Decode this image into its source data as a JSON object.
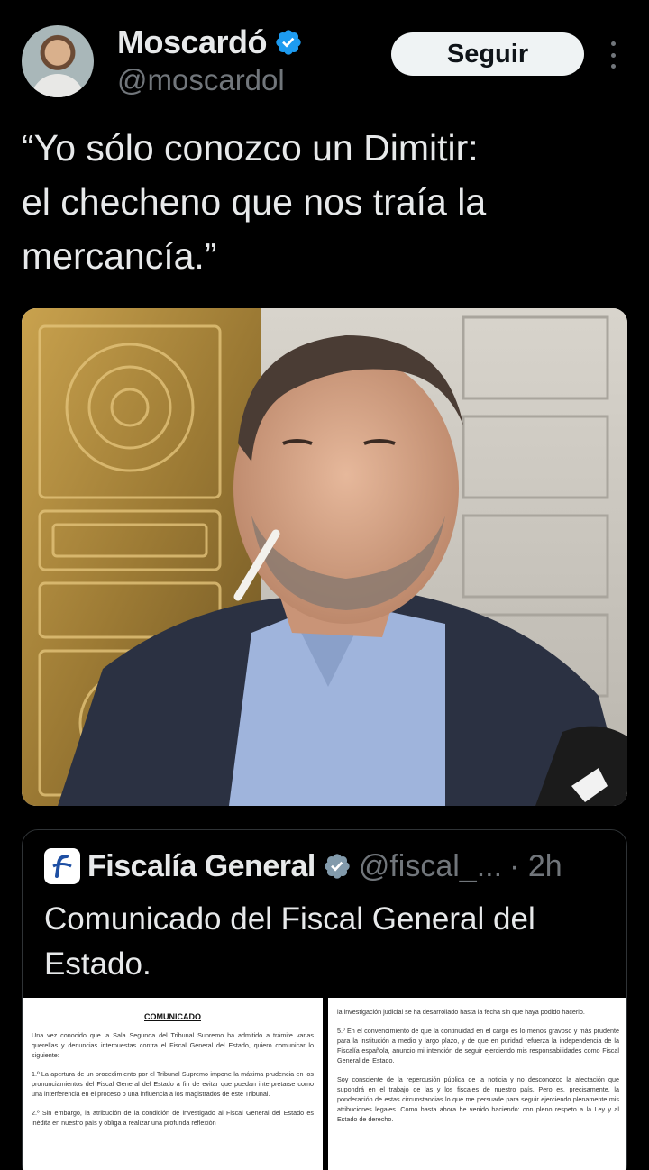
{
  "author": {
    "name": "Moscardó",
    "handle": "@moscardol",
    "verified": true
  },
  "actions": {
    "follow_label": "Seguir",
    "more_icon": "more-vertical-icon"
  },
  "tweet": {
    "text": "“Yo sólo conozco un Dimitir:\nel checheno que nos traía la\nmercancía.”"
  },
  "media": {
    "description_icon": "photo"
  },
  "quoted_tweet": {
    "author_name": "Fiscalía General",
    "author_handle": "@fiscal_...",
    "time": "· 2h",
    "text": "Comunicado del Fiscal General del Estado.",
    "documents": [
      {
        "title": "COMUNICADO",
        "paragraphs": [
          "Una vez conocido que la Sala Segunda del Tribunal Supremo ha admitido a trámite varias querellas y denuncias interpuestas contra el Fiscal General del Estado, quiero comunicar lo siguiente:",
          "1.º La apertura de un procedimiento por el Tribunal Supremo impone la máxima prudencia en los pronunciamientos del Fiscal General del Estado a fin de evitar que puedan interpretarse como una interferencia en el proceso o una influencia a los magistrados de este Tribunal.",
          "2.º Sin embargo, la atribución de la condición de investigado al Fiscal General del Estado es inédita en nuestro país y obliga a realizar una profunda reflexión"
        ]
      },
      {
        "title": "",
        "paragraphs": [
          "la investigación judicial se ha desarrollado hasta la fecha sin que haya podido hacerlo.",
          "5.º En el convencimiento de que la continuidad en el cargo es lo menos gravoso y más prudente para la institución a medio y largo plazo, y de que en puridad refuerza la independencia de la Fiscalía española, anuncio mi intención de seguir ejerciendo mis responsabilidades como Fiscal General del Estado.",
          "Soy consciente de la repercusión pública de la noticia y no desconozco la afectación que supondrá en el trabajo de las y los fiscales de nuestro país. Pero es, precisamente, la ponderación de estas circunstancias lo que me persuade para seguir ejerciendo plenamente mis atribuciones legales. Como hasta ahora he venido haciendo: con pleno respeto a la Ley y al Estado de derecho."
        ]
      }
    ]
  },
  "colors": {
    "background": "#000000",
    "text_primary": "#e7e9ea",
    "text_secondary": "#71767b",
    "verified_blue": "#1d9bf0",
    "border": "#2f3336"
  }
}
